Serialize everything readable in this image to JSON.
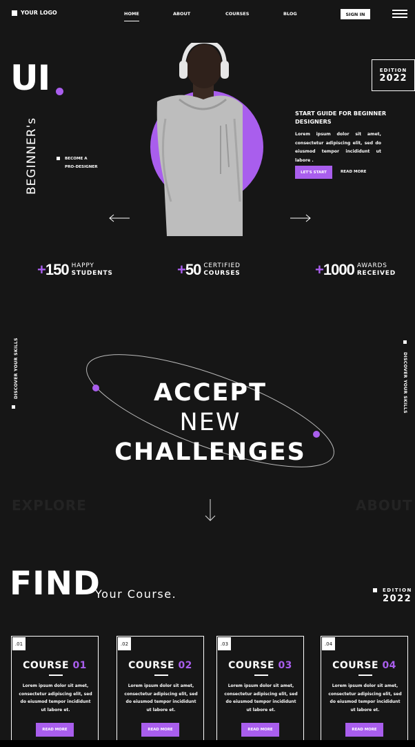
{
  "nav": {
    "logo": "YOUR LOGO",
    "items": [
      {
        "label": "HOME",
        "active": true
      },
      {
        "label": "ABOUT"
      },
      {
        "label": "COURSES"
      },
      {
        "label": "BLOG"
      }
    ],
    "signin": "SIGN IN"
  },
  "hero": {
    "ui": "UI",
    "vertical": "BEGINNER's",
    "become": [
      "BECOME A",
      "PRO-DESIGNER"
    ],
    "edition_label": "EDITION",
    "edition_year": "2022",
    "guide_title": "START GUIDE FOR BEGINNER DESIGNERS",
    "guide_text": "Lorem ipsum dolor sit amet, consectetur adipiscing elit, sed do eiusmod tempor incididunt ut labore .",
    "cta": "LET'S START",
    "read_more": "READ MORE"
  },
  "stats": [
    {
      "num": "150",
      "line1": "HAPPY",
      "line2": "STUDENTS"
    },
    {
      "num": "50",
      "line1": "CERTIFIED",
      "line2": "COURSES"
    },
    {
      "num": "1000",
      "line1": "AWARDS",
      "line2": "RECEIVED"
    }
  ],
  "challenge": {
    "side_left": "DISCOVER YOUR SKILLS",
    "side_right": "DISCOVER YOUR SKILLS",
    "line1": "ACCEPT",
    "line2": "NEW",
    "line3": "CHALLENGES",
    "explore": "EXPLORE",
    "about": "ABOUT"
  },
  "find": {
    "title": "FIND",
    "subtitle": "Your Course.",
    "edition_label": "EDITION",
    "edition_year": "2022"
  },
  "courses": [
    {
      "num": ".01",
      "label": "COURSE",
      "n": "01",
      "text": "Lorem ipsum dolor sit amet, consectetur adipiscing elit, sed do eiusmod tempor incididunt ut labore et.",
      "button": "READ MORE"
    },
    {
      "num": ".02",
      "label": "COURSE",
      "n": "02",
      "text": "Lorem ipsum dolor sit amet, consectetur adipiscing elit, sed do eiusmod tempor incididunt ut labore et.",
      "button": "READ MORE"
    },
    {
      "num": ".03",
      "label": "COURSE",
      "n": "03",
      "text": "Lorem ipsum dolor sit amet, consectetur adipiscing elit, sed do eiusmod tempor incididunt ut labore et.",
      "button": "READ MORE"
    },
    {
      "num": ".04",
      "label": "COURSE",
      "n": "04",
      "text": "Lorem ipsum dolor sit amet, consectetur adipiscing elit, sed do eiusmod tempor incididunt ut labore et.",
      "button": "READ MORE"
    }
  ],
  "colors": {
    "accent": "#a95eed",
    "background": "#161616"
  }
}
